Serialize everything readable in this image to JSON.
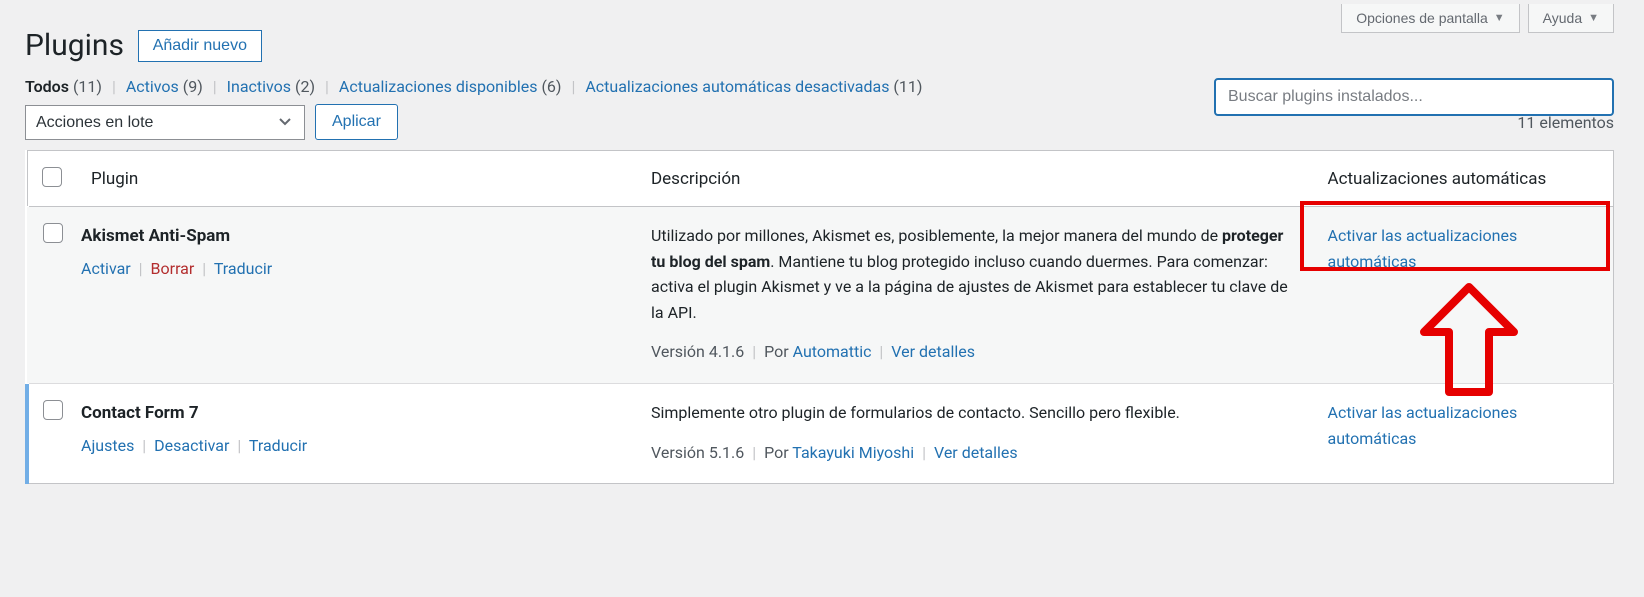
{
  "topTabs": {
    "screenOptions": "Opciones de pantalla",
    "help": "Ayuda"
  },
  "page": {
    "title": "Plugins",
    "addNew": "Añadir nuevo"
  },
  "filters": {
    "all": {
      "label": "Todos",
      "count": "(11)"
    },
    "active": {
      "label": "Activos",
      "count": "(9)"
    },
    "inactive": {
      "label": "Inactivos",
      "count": "(2)"
    },
    "available": {
      "label": "Actualizaciones disponibles",
      "count": "(6)"
    },
    "autoOff": {
      "label": "Actualizaciones automáticas desactivadas",
      "count": "(11)"
    }
  },
  "search": {
    "placeholder": "Buscar plugins instalados..."
  },
  "bulk": {
    "selected": "Acciones en lote",
    "apply": "Aplicar"
  },
  "count": "11 elementos",
  "columns": {
    "plugin": "Plugin",
    "desc": "Descripción",
    "auto": "Actualizaciones automáticas"
  },
  "rows": [
    {
      "name": "Akismet Anti-Spam",
      "actions": {
        "activate": "Activar",
        "delete": "Borrar",
        "translate": "Traducir"
      },
      "desc1": "Utilizado por millones, Akismet es, posiblemente, la mejor manera del mundo de ",
      "descBold": "proteger tu blog del spam",
      "desc2": ". Mantiene tu blog protegido incluso cuando duermes. Para comenzar: activa el plugin Akismet y ve a la página de ajustes de Akismet para establecer tu clave de la API.",
      "version": "Versión 4.1.6",
      "by": "Por ",
      "author": "Automattic",
      "details": "Ver detalles",
      "auto": "Activar las actualizaciones automáticas"
    },
    {
      "name": "Contact Form 7",
      "actions": {
        "settings": "Ajustes",
        "deactivate": "Desactivar",
        "translate": "Traducir"
      },
      "desc1": "Simplemente otro plugin de formularios de contacto. Sencillo pero flexible.",
      "version": "Versión 5.1.6",
      "by": "Por ",
      "author": "Takayuki Miyoshi",
      "details": "Ver detalles",
      "auto": "Activar las actualizaciones automáticas"
    }
  ]
}
